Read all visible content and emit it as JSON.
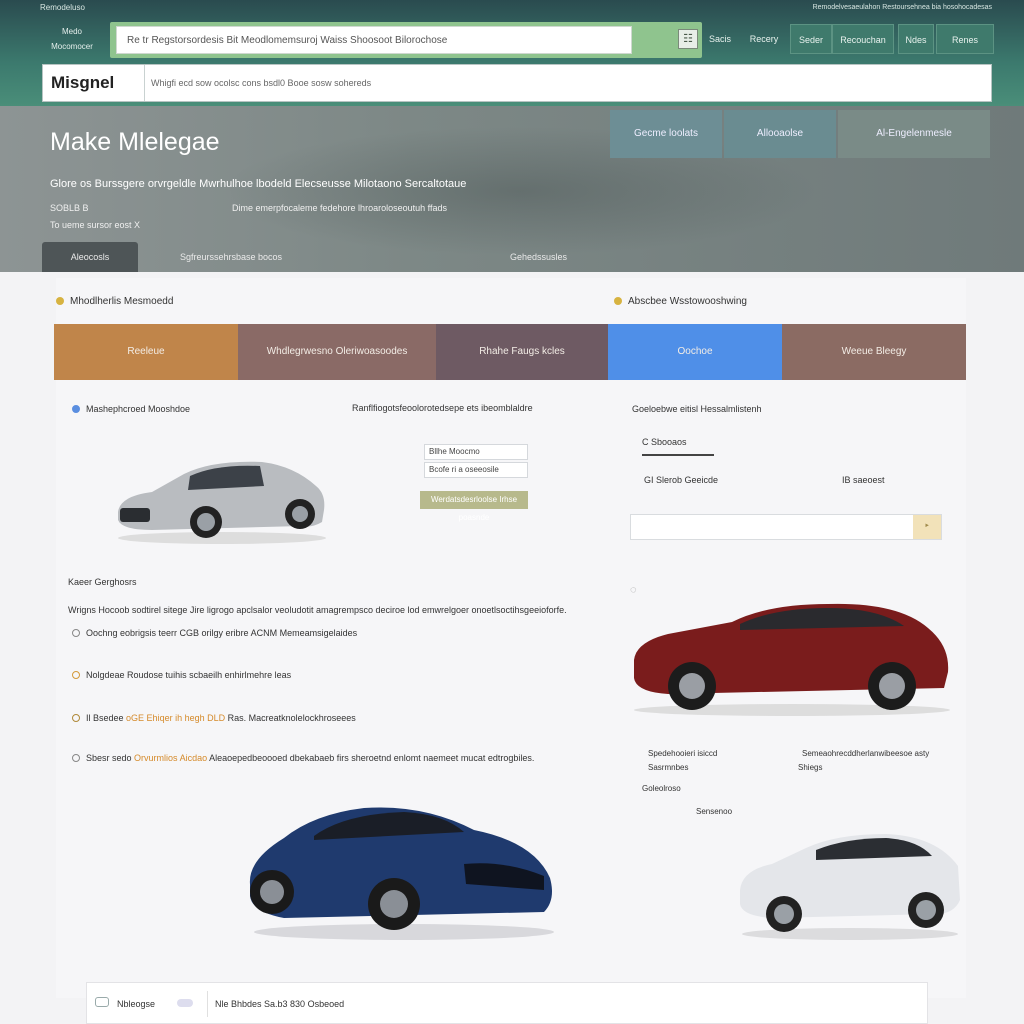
{
  "header": {
    "tiny_left": "Remodeluso",
    "tiny_right": "Remodelvesaeulahon Restoursehnea bia hosohocadesas",
    "brand_sub": "Medo Mocomocer",
    "search_placeholder": "Re tr Regstorsordesis Bit Meodlomemsuroj Waiss Shoosoot Bilorochose",
    "nav": [
      "Sacis",
      "Recery",
      "Seder",
      "Recouchan",
      "Ndes",
      "Renes"
    ]
  },
  "hero_search": {
    "label": "Misgnel",
    "placeholder": "Whigfi ecd sow ocolsc cons bsdl0 Booe sosw sohereds"
  },
  "hero": {
    "title": "Make Mlelegae",
    "subtitle": "Glore os Burssgere orvrgeldle Mwrhulhoe lbodeld Elecseusse Milotaono Sercaltotaue",
    "meta1": "SOBLB B",
    "meta2": "Dime emerpfocaleme fedehore lhroaroloseoutuh ffads",
    "meta3": "To ueme sursor eost X",
    "buttons": [
      "Gecme loolats",
      "Allooaolse",
      "Al-Engelenmesle"
    ],
    "tabs": [
      "Aleocosls",
      "Sgfreurssehrsbase bocos",
      "Gehedssusles"
    ]
  },
  "sections": {
    "left_head": "Mhodlherlis Mesmoedd",
    "right_head": "Abscbee Wsstowooshwing"
  },
  "categories": [
    "Reeleue",
    "Whdlegrwesno Oleriwoasoodes",
    "Rhahe Faugs kcles",
    "Oochoe",
    "Weeue Bleegy"
  ],
  "left": {
    "radio_label": "Mashephcroed Mooshdoe",
    "center_head": "Ranflfiogotsfeoolorotedsepe ets ibeomblaldre",
    "input1": "Bllhe Moocmo",
    "input2": "Bcofe ri a oseeosile",
    "button": "Werdatsdesrloolse Irhse poasnde",
    "subhead": "Kaeer Gerghosrs",
    "line1": "Wrigns Hocoob sodtirel sitege Jire ligrogo apclsalor veoludotit amagrempsco deciroe lod emwrelgoer onoetlsoctihsgeeioforfe.",
    "line2": "Oochng eobrigsis teerr CGB orilgy eribre ACNM Memeamsigelaides",
    "line3": "Nolgdeae Roudose tuihis scbaeilh enhirlmehre leas",
    "line4_a": "Il Bsedee",
    "line4_b": "oGE Ehiqer",
    "line4_c": "ih hegh DLD",
    "line4_d": "Ras. Macreatknolelockhroseees",
    "line5_a": "Sbesr sedo",
    "line5_b": "Orvurmlios",
    "line5_c": "Aicdao",
    "line5_d": "Aleaoepedbeoooed dbekabaeb firs sheroetnd enlomt naemeet mucat edtrogbiles."
  },
  "right": {
    "head": "Goeloebwe eitisl Hessalmlistenh",
    "tab": "C Sbooaos",
    "row_a": "GI Slerob Geeicde",
    "row_b": "IB saeoest",
    "spec1": "Spedehooieri isiccd",
    "spec1b": "Sasrmnbes",
    "spec2": "Semeaohrecddherlanwibeesoe asty",
    "spec2b": "Shiegs",
    "spec3": "Goleolroso",
    "spec4": "Sensenoo"
  },
  "footer": {
    "text_a": "Nbleogse",
    "text_b": "Nle Bhbdes Sa.b3 830 Osbeoed"
  },
  "colors": {
    "header_green": "#3c7a6e",
    "cat1": "#c0854a",
    "cat4": "#4f8fe8"
  }
}
